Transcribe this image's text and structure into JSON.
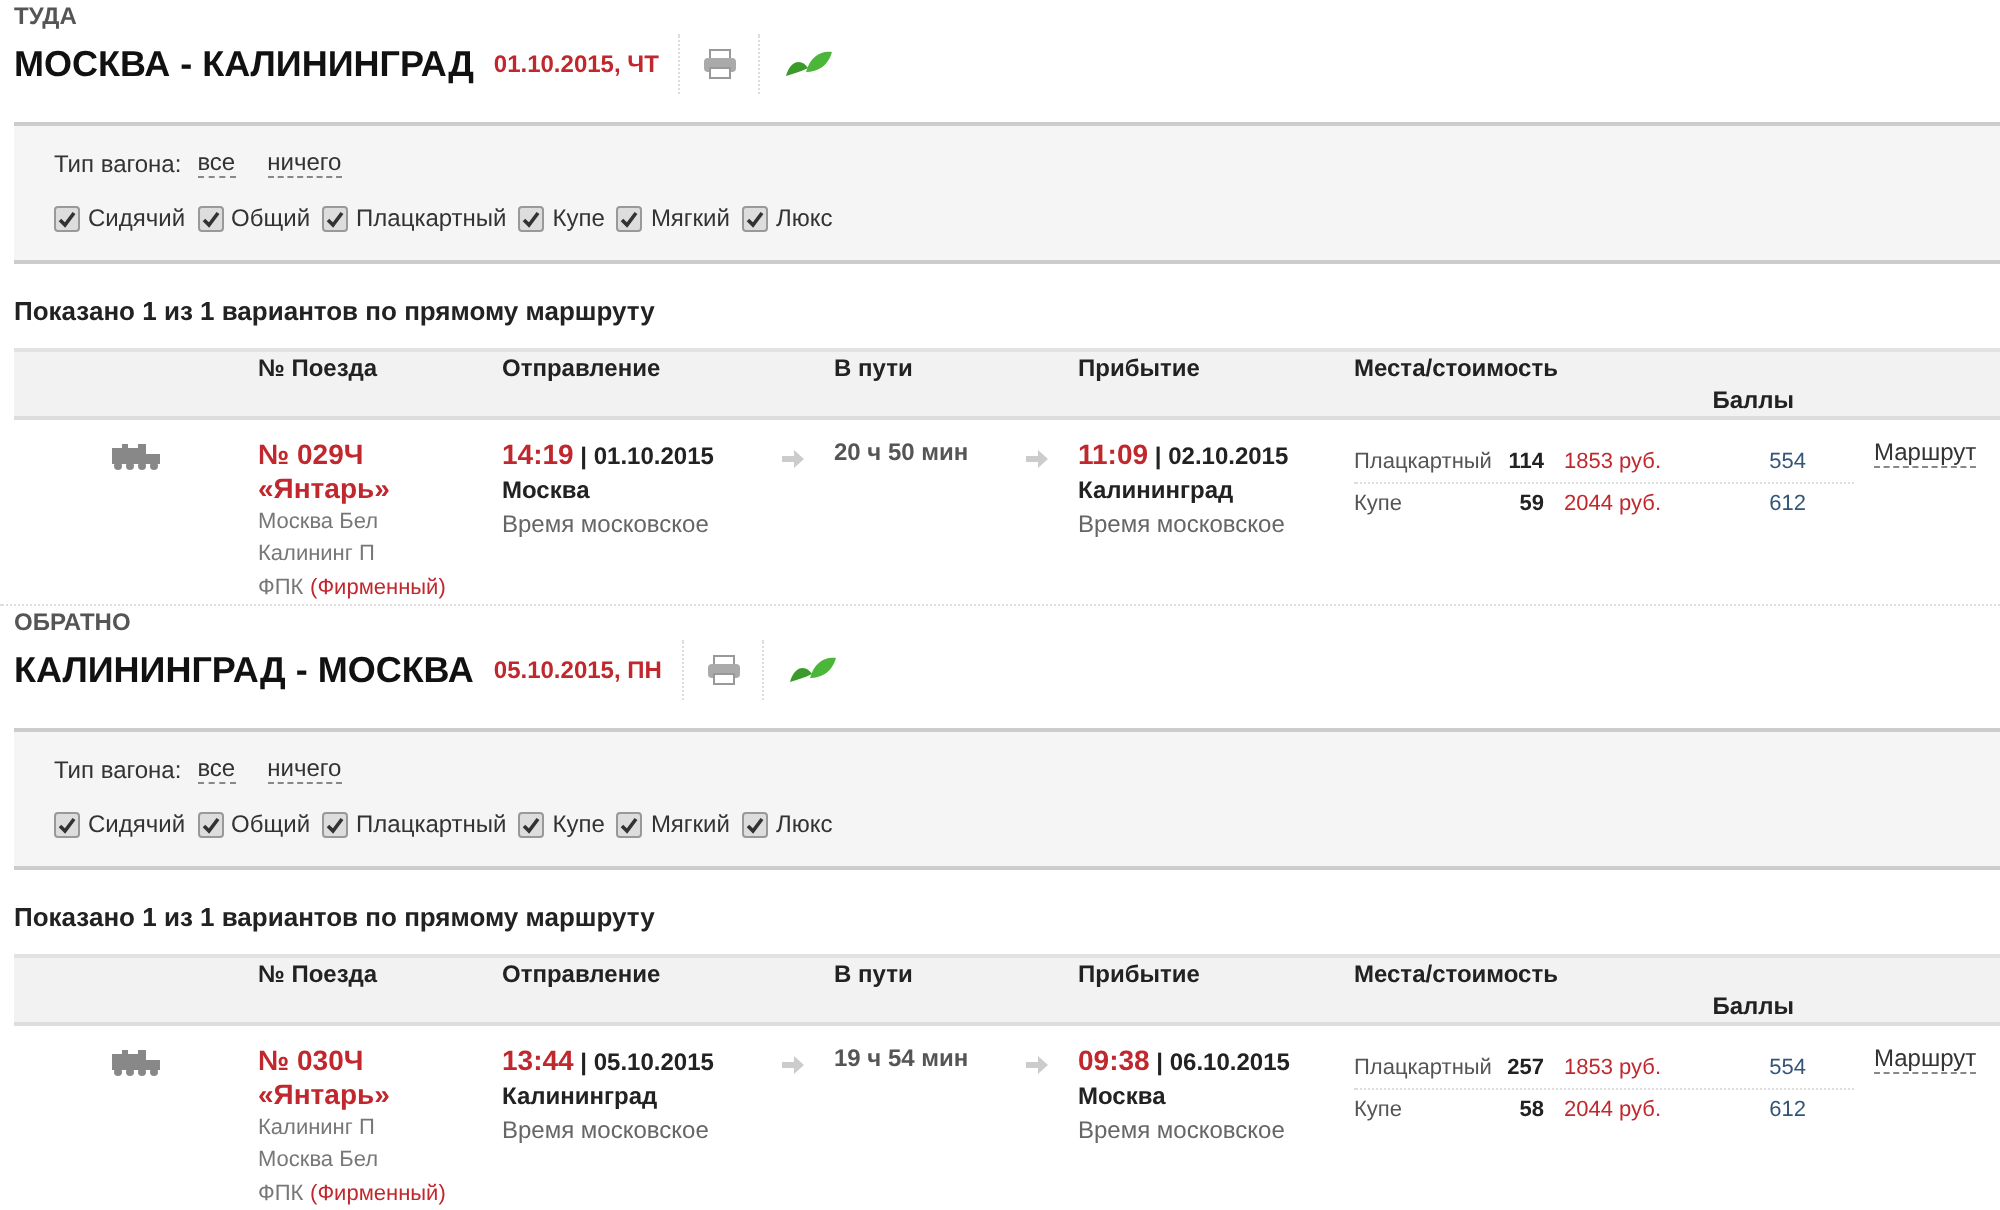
{
  "sections": [
    {
      "direction": "ТУДА",
      "route": "МОСКВА - КАЛИНИНГРАД",
      "date": "01.10.2015, ЧТ",
      "filter": {
        "label": "Тип вагона:",
        "links": [
          "все",
          "ничего"
        ],
        "options": [
          {
            "label": "Сидячий",
            "checked": true
          },
          {
            "label": "Общий",
            "checked": true
          },
          {
            "label": "Плацкартный",
            "checked": true
          },
          {
            "label": "Купе",
            "checked": true
          },
          {
            "label": "Мягкий",
            "checked": true
          },
          {
            "label": "Люкс",
            "checked": true
          }
        ]
      },
      "summary": "Показано 1 из 1 вариантов по прямому маршруту",
      "columns": [
        "№ Поезда",
        "Отправление",
        "В пути",
        "Прибытие",
        "Места/стоимость",
        "Баллы"
      ],
      "trains": [
        {
          "number": "№ 029Ч",
          "name": "«Янтарь»",
          "stations": [
            "Москва Бел",
            "Калининг П"
          ],
          "carrier": "ФПК",
          "category": "(Фирменный)",
          "departure": {
            "time": "14:19",
            "separator": "|",
            "date": "01.10.2015",
            "station": "Москва",
            "timezone": "Время московское"
          },
          "duration": "20 ч 50 мин",
          "arrival": {
            "time": "11:09",
            "separator": "|",
            "date": "02.10.2015",
            "station": "Калининград",
            "timezone": "Время московское"
          },
          "fares": [
            {
              "class": "Плацкартный",
              "seats": "114",
              "price": "1853 руб.",
              "points": "554"
            },
            {
              "class": "Купе",
              "seats": "59",
              "price": "2044 руб.",
              "points": "612"
            }
          ],
          "route_link": "Маршрут"
        }
      ]
    },
    {
      "direction": "ОБРАТНО",
      "route": "КАЛИНИНГРАД - МОСКВА",
      "date": "05.10.2015, ПН",
      "filter": {
        "label": "Тип вагона:",
        "links": [
          "все",
          "ничего"
        ],
        "options": [
          {
            "label": "Сидячий",
            "checked": true
          },
          {
            "label": "Общий",
            "checked": true
          },
          {
            "label": "Плацкартный",
            "checked": true
          },
          {
            "label": "Купе",
            "checked": true
          },
          {
            "label": "Мягкий",
            "checked": true
          },
          {
            "label": "Люкс",
            "checked": true
          }
        ]
      },
      "summary": "Показано 1 из 1 вариантов по прямому маршруту",
      "columns": [
        "№ Поезда",
        "Отправление",
        "В пути",
        "Прибытие",
        "Места/стоимость",
        "Баллы"
      ],
      "trains": [
        {
          "number": "№ 030Ч",
          "name": "«Янтарь»",
          "stations": [
            "Калининг П",
            "Москва Бел"
          ],
          "carrier": "ФПК",
          "category": "(Фирменный)",
          "departure": {
            "time": "13:44",
            "separator": "|",
            "date": "05.10.2015",
            "station": "Калининград",
            "timezone": "Время московское"
          },
          "duration": "19 ч 54 мин",
          "arrival": {
            "time": "09:38",
            "separator": "|",
            "date": "06.10.2015",
            "station": "Москва",
            "timezone": "Время московское"
          },
          "fares": [
            {
              "class": "Плацкартный",
              "seats": "257",
              "price": "1853 руб.",
              "points": "554"
            },
            {
              "class": "Купе",
              "seats": "58",
              "price": "2044 руб.",
              "points": "612"
            }
          ],
          "route_link": "Маршрут"
        }
      ]
    }
  ]
}
